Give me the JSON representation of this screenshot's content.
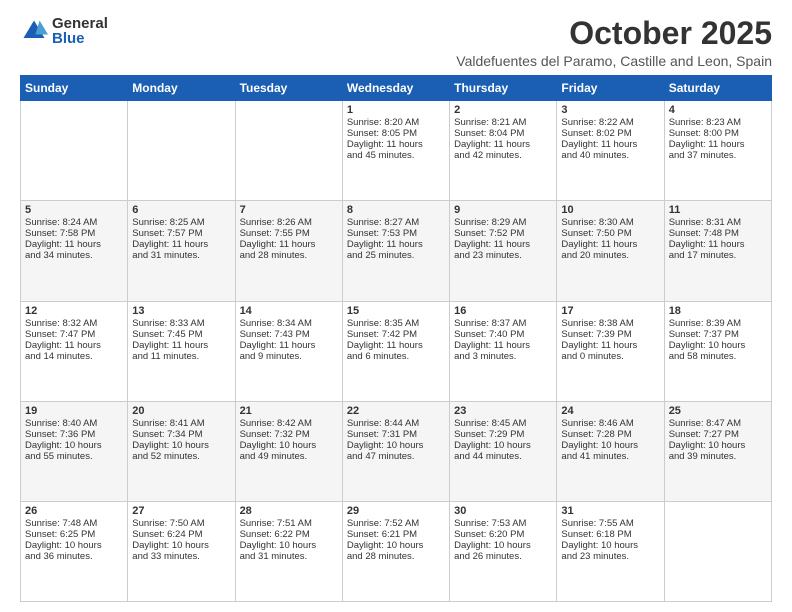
{
  "logo": {
    "general": "General",
    "blue": "Blue"
  },
  "title": "October 2025",
  "subtitle": "Valdefuentes del Paramo, Castille and Leon, Spain",
  "headers": [
    "Sunday",
    "Monday",
    "Tuesday",
    "Wednesday",
    "Thursday",
    "Friday",
    "Saturday"
  ],
  "weeks": [
    [
      {
        "day": "",
        "text": ""
      },
      {
        "day": "",
        "text": ""
      },
      {
        "day": "",
        "text": ""
      },
      {
        "day": "1",
        "text": "Sunrise: 8:20 AM\nSunset: 8:05 PM\nDaylight: 11 hours\nand 45 minutes."
      },
      {
        "day": "2",
        "text": "Sunrise: 8:21 AM\nSunset: 8:04 PM\nDaylight: 11 hours\nand 42 minutes."
      },
      {
        "day": "3",
        "text": "Sunrise: 8:22 AM\nSunset: 8:02 PM\nDaylight: 11 hours\nand 40 minutes."
      },
      {
        "day": "4",
        "text": "Sunrise: 8:23 AM\nSunset: 8:00 PM\nDaylight: 11 hours\nand 37 minutes."
      }
    ],
    [
      {
        "day": "5",
        "text": "Sunrise: 8:24 AM\nSunset: 7:58 PM\nDaylight: 11 hours\nand 34 minutes."
      },
      {
        "day": "6",
        "text": "Sunrise: 8:25 AM\nSunset: 7:57 PM\nDaylight: 11 hours\nand 31 minutes."
      },
      {
        "day": "7",
        "text": "Sunrise: 8:26 AM\nSunset: 7:55 PM\nDaylight: 11 hours\nand 28 minutes."
      },
      {
        "day": "8",
        "text": "Sunrise: 8:27 AM\nSunset: 7:53 PM\nDaylight: 11 hours\nand 25 minutes."
      },
      {
        "day": "9",
        "text": "Sunrise: 8:29 AM\nSunset: 7:52 PM\nDaylight: 11 hours\nand 23 minutes."
      },
      {
        "day": "10",
        "text": "Sunrise: 8:30 AM\nSunset: 7:50 PM\nDaylight: 11 hours\nand 20 minutes."
      },
      {
        "day": "11",
        "text": "Sunrise: 8:31 AM\nSunset: 7:48 PM\nDaylight: 11 hours\nand 17 minutes."
      }
    ],
    [
      {
        "day": "12",
        "text": "Sunrise: 8:32 AM\nSunset: 7:47 PM\nDaylight: 11 hours\nand 14 minutes."
      },
      {
        "day": "13",
        "text": "Sunrise: 8:33 AM\nSunset: 7:45 PM\nDaylight: 11 hours\nand 11 minutes."
      },
      {
        "day": "14",
        "text": "Sunrise: 8:34 AM\nSunset: 7:43 PM\nDaylight: 11 hours\nand 9 minutes."
      },
      {
        "day": "15",
        "text": "Sunrise: 8:35 AM\nSunset: 7:42 PM\nDaylight: 11 hours\nand 6 minutes."
      },
      {
        "day": "16",
        "text": "Sunrise: 8:37 AM\nSunset: 7:40 PM\nDaylight: 11 hours\nand 3 minutes."
      },
      {
        "day": "17",
        "text": "Sunrise: 8:38 AM\nSunset: 7:39 PM\nDaylight: 11 hours\nand 0 minutes."
      },
      {
        "day": "18",
        "text": "Sunrise: 8:39 AM\nSunset: 7:37 PM\nDaylight: 10 hours\nand 58 minutes."
      }
    ],
    [
      {
        "day": "19",
        "text": "Sunrise: 8:40 AM\nSunset: 7:36 PM\nDaylight: 10 hours\nand 55 minutes."
      },
      {
        "day": "20",
        "text": "Sunrise: 8:41 AM\nSunset: 7:34 PM\nDaylight: 10 hours\nand 52 minutes."
      },
      {
        "day": "21",
        "text": "Sunrise: 8:42 AM\nSunset: 7:32 PM\nDaylight: 10 hours\nand 49 minutes."
      },
      {
        "day": "22",
        "text": "Sunrise: 8:44 AM\nSunset: 7:31 PM\nDaylight: 10 hours\nand 47 minutes."
      },
      {
        "day": "23",
        "text": "Sunrise: 8:45 AM\nSunset: 7:29 PM\nDaylight: 10 hours\nand 44 minutes."
      },
      {
        "day": "24",
        "text": "Sunrise: 8:46 AM\nSunset: 7:28 PM\nDaylight: 10 hours\nand 41 minutes."
      },
      {
        "day": "25",
        "text": "Sunrise: 8:47 AM\nSunset: 7:27 PM\nDaylight: 10 hours\nand 39 minutes."
      }
    ],
    [
      {
        "day": "26",
        "text": "Sunrise: 7:48 AM\nSunset: 6:25 PM\nDaylight: 10 hours\nand 36 minutes."
      },
      {
        "day": "27",
        "text": "Sunrise: 7:50 AM\nSunset: 6:24 PM\nDaylight: 10 hours\nand 33 minutes."
      },
      {
        "day": "28",
        "text": "Sunrise: 7:51 AM\nSunset: 6:22 PM\nDaylight: 10 hours\nand 31 minutes."
      },
      {
        "day": "29",
        "text": "Sunrise: 7:52 AM\nSunset: 6:21 PM\nDaylight: 10 hours\nand 28 minutes."
      },
      {
        "day": "30",
        "text": "Sunrise: 7:53 AM\nSunset: 6:20 PM\nDaylight: 10 hours\nand 26 minutes."
      },
      {
        "day": "31",
        "text": "Sunrise: 7:55 AM\nSunset: 6:18 PM\nDaylight: 10 hours\nand 23 minutes."
      },
      {
        "day": "",
        "text": ""
      }
    ]
  ]
}
